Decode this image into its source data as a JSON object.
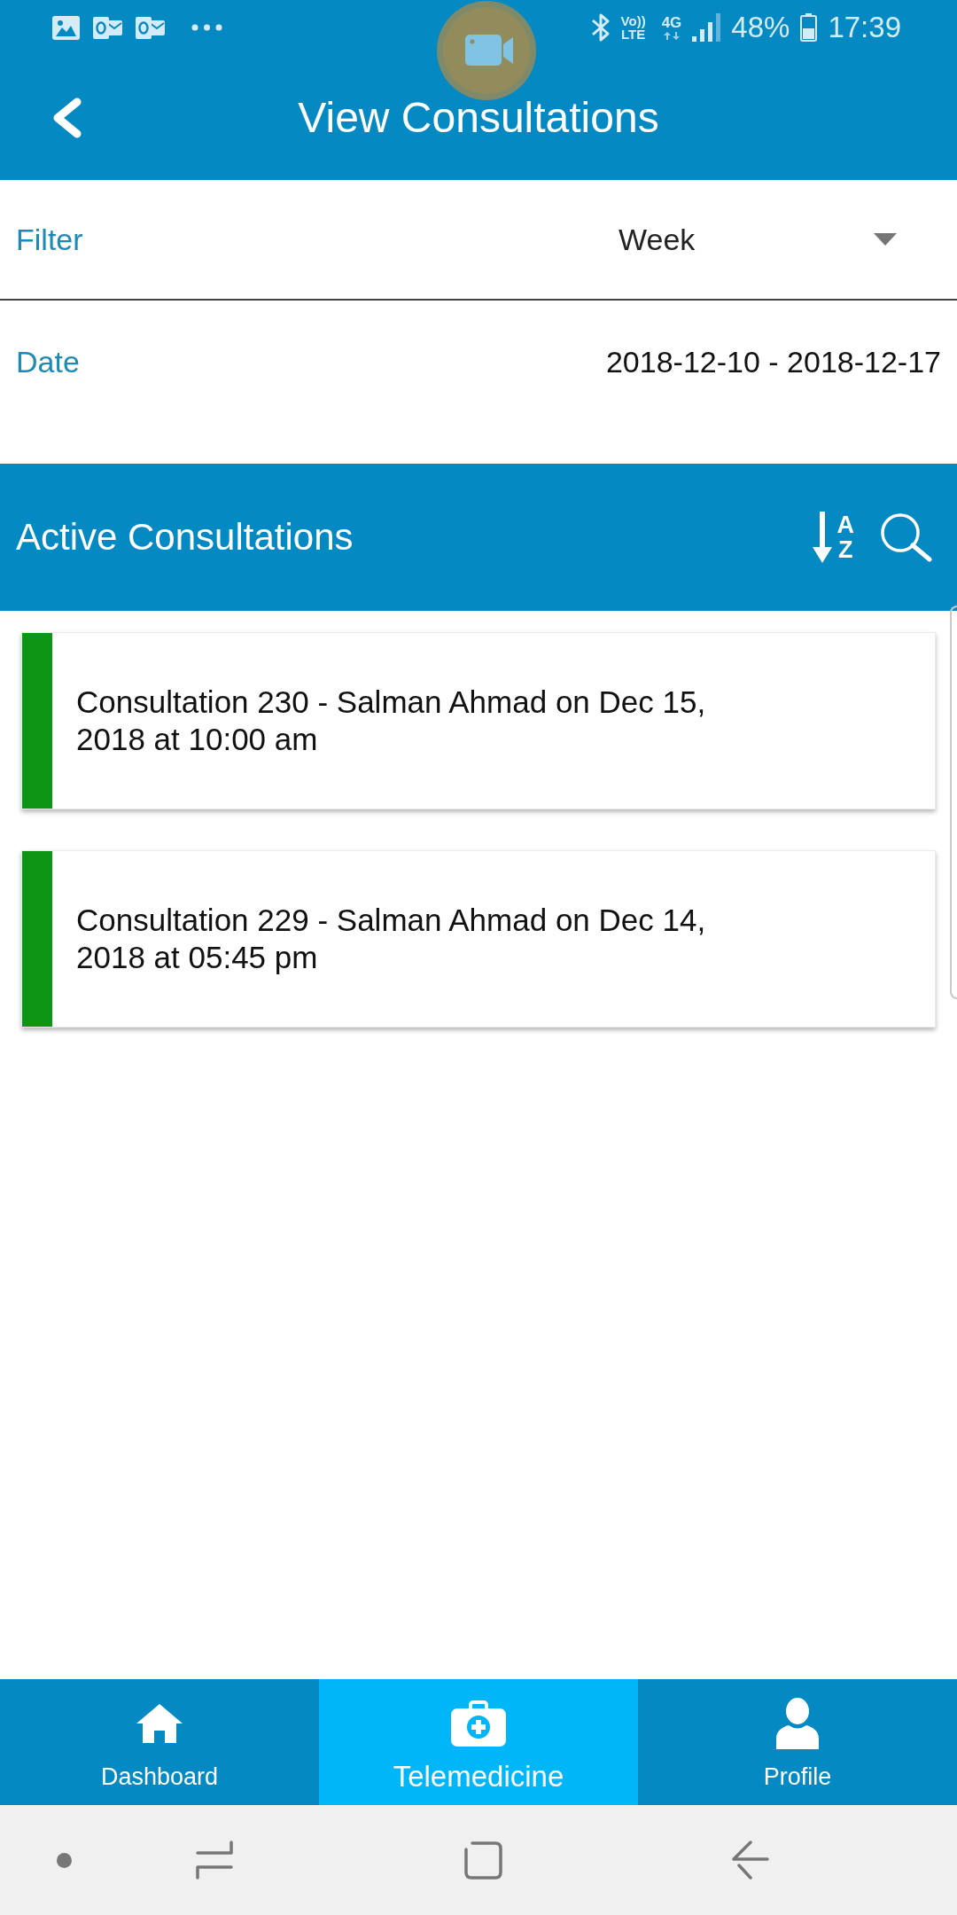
{
  "status_bar": {
    "network_label": [
      "Vo))",
      "LTE"
    ],
    "network_type": "4G",
    "battery": "48%",
    "time": "17:39"
  },
  "app_bar": {
    "title": "View Consultations"
  },
  "filter": {
    "label": "Filter",
    "value": "Week"
  },
  "date": {
    "label": "Date",
    "value": "2018-12-10 - 2018-12-17"
  },
  "section": {
    "title": "Active Consultations",
    "sort_letters": [
      "A",
      "Z"
    ]
  },
  "consultations": [
    {
      "text": "Consultation 230 - Salman Ahmad on Dec 15, 2018 at 10:00 am",
      "color": "#0d9615"
    },
    {
      "text": "Consultation 229 - Salman Ahmad on Dec 14, 2018 at 05:45 pm",
      "color": "#0d9615"
    }
  ],
  "bottom_nav": {
    "tabs": [
      {
        "label": "Dashboard",
        "selected": false
      },
      {
        "label": "Telemedicine",
        "selected": true
      },
      {
        "label": "Profile",
        "selected": false
      }
    ]
  }
}
